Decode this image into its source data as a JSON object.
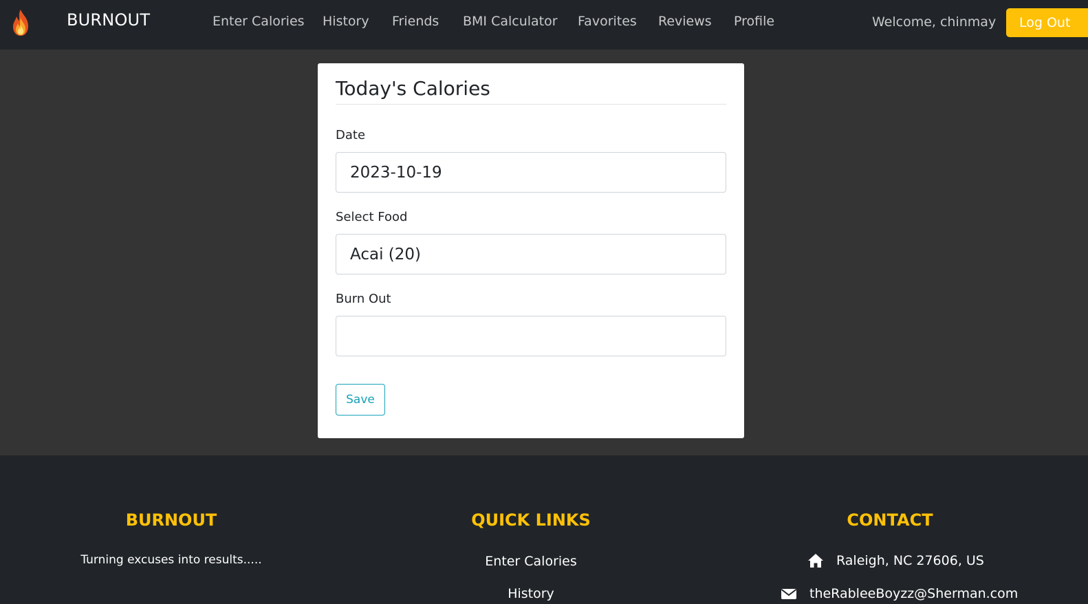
{
  "navbar": {
    "brand": "BURNOUT",
    "links": [
      {
        "label": "Enter Calories"
      },
      {
        "label": "History"
      },
      {
        "label": "Friends"
      },
      {
        "label": "BMI Calculator"
      },
      {
        "label": "Favorites"
      },
      {
        "label": "Reviews"
      },
      {
        "label": "Profile"
      }
    ],
    "welcome_text": "Welcome, chinmay",
    "logout_label": "Log Out",
    "logo_icon": "flame-icon"
  },
  "form": {
    "title": "Today's Calories",
    "date_label": "Date",
    "date_value": "2023-10-19",
    "food_label": "Select Food",
    "food_value": "Acai (20)",
    "burnout_label": "Burn Out",
    "burnout_value": "",
    "save_label": "Save"
  },
  "footer": {
    "about": {
      "heading": "BURNOUT",
      "tagline": "Turning excuses into results....."
    },
    "quick_links": {
      "heading": "QUICK LINKS",
      "links": [
        "Enter Calories",
        "History"
      ]
    },
    "contact": {
      "heading": "CONTACT",
      "address": "Raleigh, NC 27606, US",
      "email": "theRableeBoyzz@Sherman.com",
      "address_icon": "home-icon",
      "email_icon": "envelope-icon"
    }
  },
  "colors": {
    "navbar_bg": "#212529",
    "page_bg": "#343434",
    "accent_yellow": "#ffc107",
    "save_button": "#17a2b8"
  }
}
